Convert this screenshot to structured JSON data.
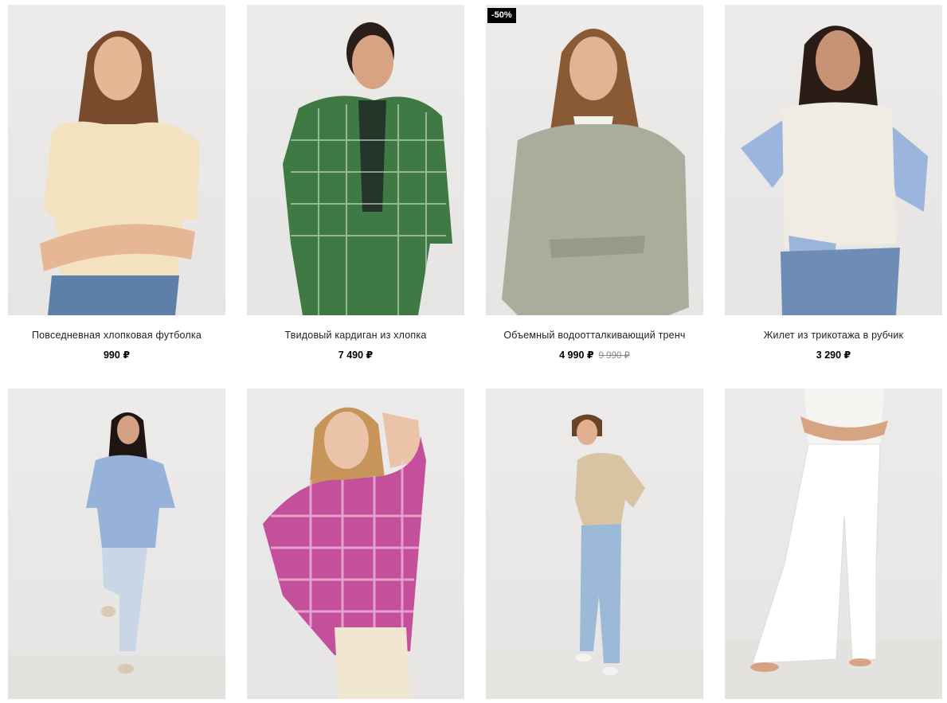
{
  "products": [
    {
      "title": "Повседневная хлопковая футболка",
      "price": "990 ₽",
      "old_price": "",
      "badge": "",
      "colors": {
        "hair": "#7a4a2c",
        "top": "#f3e2bf",
        "bottom": "#5d7fa8",
        "skin": "#e6b695"
      }
    },
    {
      "title": "Твидовый кардиган из хлопка",
      "price": "7 490 ₽",
      "old_price": "",
      "badge": "",
      "colors": {
        "hair": "#2a1e18",
        "top": "#3f7a45",
        "bottom": "#2c3f6a",
        "skin": "#d8a382"
      }
    },
    {
      "title": "Объемный водоотталкивающий тренч",
      "price": "4 990 ₽",
      "old_price": "9 990 ₽",
      "badge": "-50%",
      "colors": {
        "hair": "#8a5a35",
        "top": "#a9ae9c",
        "bottom": "#a9ae9c",
        "skin": "#e2b394"
      }
    },
    {
      "title": "Жилет из трикотажа в рубчик",
      "price": "3 290 ₽",
      "old_price": "",
      "badge": "",
      "colors": {
        "hair": "#2b1d15",
        "top": "#f1ece3",
        "bottom": "#6e8db6",
        "skin": "#c89275"
      }
    },
    {
      "title": "",
      "price": "",
      "old_price": "",
      "badge": "",
      "colors": {
        "hair": "#1f1612",
        "top": "#97b2d8",
        "bottom": "#c8d6e6",
        "skin": "#d5a285"
      }
    },
    {
      "title": "",
      "price": "",
      "old_price": "",
      "badge": "",
      "colors": {
        "hair": "#c7945a",
        "top": "#c44f9a",
        "bottom": "#f0e6d2",
        "skin": "#ebc3a8"
      }
    },
    {
      "title": "",
      "price": "",
      "old_price": "",
      "badge": "",
      "colors": {
        "hair": "#6a4328",
        "top": "#d8c3a3",
        "bottom": "#9cbad8",
        "skin": "#e0b090"
      }
    },
    {
      "title": "",
      "price": "",
      "old_price": "",
      "badge": "",
      "colors": {
        "hair": "#2a1d14",
        "top": "#f6f4f0",
        "bottom": "#ffffff",
        "skin": "#d7a483"
      }
    }
  ]
}
